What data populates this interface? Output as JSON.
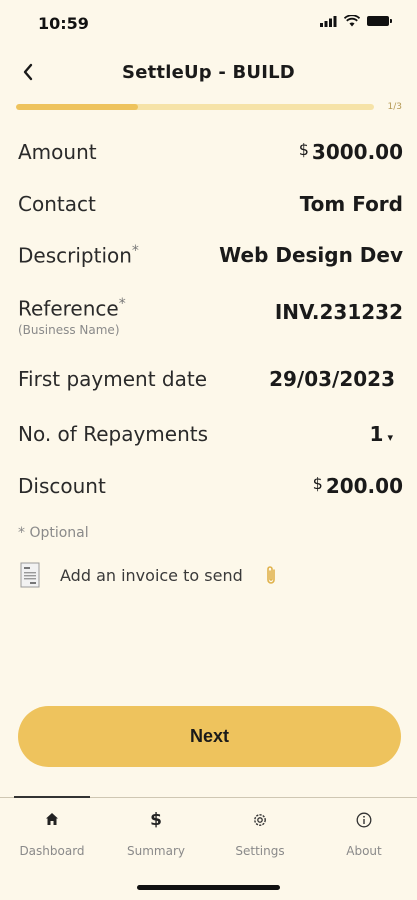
{
  "status": {
    "time": "10:59"
  },
  "header": {
    "title": "SettleUp - BUILD"
  },
  "progress": {
    "label": "1/3",
    "fraction": 0.34
  },
  "form": {
    "amount": {
      "label": "Amount",
      "currency": "$",
      "value": "3000.00"
    },
    "contact": {
      "label": "Contact",
      "value": "Tom Ford"
    },
    "description": {
      "label": "Description",
      "required": "*",
      "value": "Web Design Dev"
    },
    "reference": {
      "label": "Reference",
      "required": "*",
      "sub": "(Business Name)",
      "value": "INV.231232"
    },
    "first_payment": {
      "label": "First payment date",
      "value": "29/03/2023"
    },
    "repayments": {
      "label": "No. of Repayments",
      "value": "1",
      "arrow": "▾"
    },
    "discount": {
      "label": "Discount",
      "currency": "$",
      "value": "200.00"
    },
    "optional_note": "* Optional",
    "attach": {
      "text": "Add an invoice to send"
    }
  },
  "next_button": {
    "label": "Next"
  },
  "tabs": [
    {
      "label": "Dashboard",
      "icon": "home-icon",
      "active": true
    },
    {
      "label": "Summary",
      "icon": "dollar-icon",
      "active": false
    },
    {
      "label": "Settings",
      "icon": "gear-icon",
      "active": false
    },
    {
      "label": "About",
      "icon": "info-icon",
      "active": false
    }
  ],
  "colors": {
    "background": "#fdf8ea",
    "accent": "#eec35d",
    "track": "#f6e3a8"
  }
}
